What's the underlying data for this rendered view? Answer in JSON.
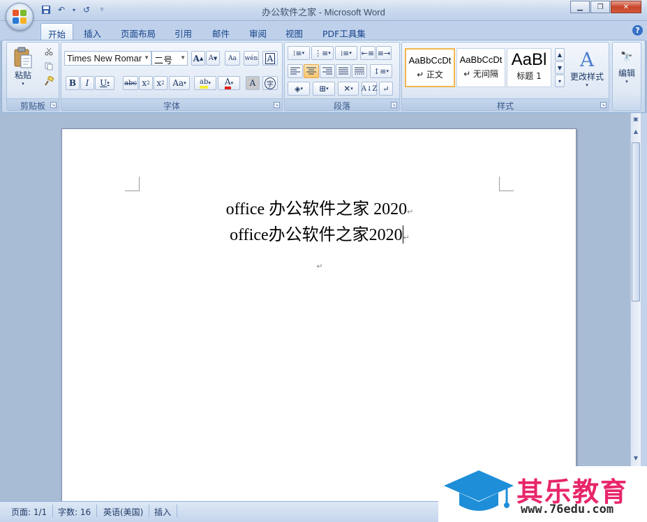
{
  "window": {
    "title": "办公软件之家 - Microsoft Word"
  },
  "tabs": [
    "开始",
    "插入",
    "页面布局",
    "引用",
    "邮件",
    "审阅",
    "视图",
    "PDF工具集"
  ],
  "ribbon": {
    "clipboard": {
      "label": "剪贴板",
      "paste_label": "粘贴"
    },
    "font": {
      "label": "字体",
      "font_name": "Times New Romar",
      "font_size": "二号"
    },
    "paragraph": {
      "label": "段落"
    },
    "styles": {
      "label": "样式",
      "items": [
        {
          "preview": "AaBbCcDt",
          "name": "↵ 正文"
        },
        {
          "preview": "AaBbCcDt",
          "name": "↵ 无间隔"
        },
        {
          "preview": "AaBl",
          "name": "标题 1"
        }
      ],
      "change_styles_label": "更改样式"
    },
    "editing": {
      "label": "编辑"
    }
  },
  "document": {
    "lines": [
      "office 办公软件之家 2020",
      "office办公软件之家2020"
    ],
    "paragraph_mark": "↵"
  },
  "status": {
    "page": "页面: 1/1",
    "words": "字数: 16",
    "language": "英语(美国)",
    "mode": "插入"
  },
  "watermark": {
    "brand": "其乐教育",
    "url": "www.76edu.com"
  },
  "colors": {
    "accent": "#15428b",
    "watermark_pink": "#e8256a",
    "watermark_blue": "#1e8ed8"
  }
}
